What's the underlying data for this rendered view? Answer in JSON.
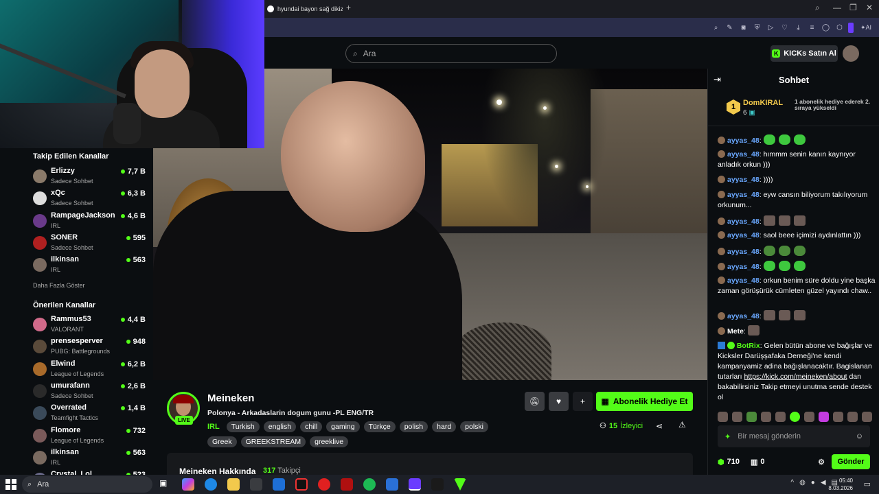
{
  "browser": {
    "tab_title": "hyundai bayon sağ dikiz a",
    "new_tab": "+",
    "controls": {
      "minimize": "—",
      "maximize": "❐",
      "close": "✕"
    },
    "ai_label": "AI"
  },
  "header": {
    "search_placeholder": "Ara",
    "buy_kicks_label": "KICKs Satın Al"
  },
  "sidebar": {
    "followed_title": "Takip Edilen Kanallar",
    "followed": [
      {
        "name": "Erlizzy",
        "category": "Sadece Sohbet",
        "viewers": "7,7 B"
      },
      {
        "name": "xQc",
        "category": "Sadece Sohbet",
        "viewers": "6,3 B"
      },
      {
        "name": "RampageJackson",
        "category": "IRL",
        "viewers": "4,6 B"
      },
      {
        "name": "SONER",
        "category": "Sadece Sohbet",
        "viewers": "595"
      },
      {
        "name": "ilkinsan",
        "category": "IRL",
        "viewers": "563"
      }
    ],
    "show_more": "Daha Fazla Göster",
    "recommended_title": "Önerilen Kanallar",
    "recommended": [
      {
        "name": "Rammus53",
        "category": "VALORANT",
        "viewers": "4,4 B"
      },
      {
        "name": "prensesperver",
        "category": "PUBG: Battlegrounds",
        "viewers": "948"
      },
      {
        "name": "Elwind",
        "category": "League of Legends",
        "viewers": "6,2 B"
      },
      {
        "name": "umurafann",
        "category": "Sadece Sohbet",
        "viewers": "2,6 B"
      },
      {
        "name": "Overrated",
        "category": "Teamfight Tactics",
        "viewers": "1,4 B"
      },
      {
        "name": "Flomore",
        "category": "League of Legends",
        "viewers": "732"
      },
      {
        "name": "ilkinsan",
        "category": "IRL",
        "viewers": "563"
      },
      {
        "name": "Crystal_Lol",
        "category": "",
        "viewers": "523"
      }
    ]
  },
  "stream": {
    "channel_name": "Meineken",
    "live_label": "LIVE",
    "title": "Polonya - Arkadaslarin dogum gunu -PL ENG/TR",
    "category": "IRL",
    "tags": [
      "Turkish",
      "english",
      "chill",
      "gaming",
      "Türkçe",
      "polish",
      "hard",
      "polski",
      "Greek",
      "GREEKSTREAM",
      "greeklive"
    ],
    "gift_sub_label": "Abonelik Hediye Et",
    "viewer_count": "15",
    "viewer_word": "İzleyici",
    "about_title": "Meineken Hakkında",
    "followers_count": "317",
    "followers_word": "Takipçi"
  },
  "chat": {
    "title": "Sohbet",
    "pinned": {
      "rank": "1",
      "name": "DomKIRAL",
      "count": "6",
      "note": "1 abonelik hediye ederek 2. sıraya yükseldi"
    },
    "messages": [
      {
        "user": "ayyas_48",
        "text": ""
      },
      {
        "user": "ayyas_48",
        "text": "hımmm senin kanın kaynıyor anladık orkun )))"
      },
      {
        "user": "ayyas_48",
        "text": "))))"
      },
      {
        "user": "ayyas_48",
        "text": "eyw cansın biliyorum takılıyorum orkunum..."
      },
      {
        "user": "ayyas_48",
        "text": ""
      },
      {
        "user": "ayyas_48",
        "text": "saol beee içimizi aydınlattın )))"
      },
      {
        "user": "ayyas_48",
        "text": ""
      },
      {
        "user": "ayyas_48",
        "text": ""
      },
      {
        "user": "ayyas_48",
        "text": "orkun benim süre doldu yine başka zaman görüşürük cümleten güzel yayındı chaw.."
      },
      {
        "user": "ayyas_48",
        "text": ""
      },
      {
        "user": "Mete",
        "text": ""
      }
    ],
    "bot": {
      "user": "BotRix",
      "text": "Gelen bütün abone ve bağışlar ve Kicksler Darüşşafaka Derneği'ne kendi kampanyamiz adina bağışlanacaktır. Bagislanan tutarları",
      "link": "https://kick.com/meineken/about",
      "text_after": "dan bakabilirsiniz Takip etmeyi unutma sende destek ol"
    },
    "input_placeholder": "Bir mesaj gönderin",
    "points": "710",
    "kicks": "0",
    "send_label": "Gönder"
  },
  "taskbar": {
    "search_placeholder": "Ara",
    "time": "05:40",
    "date": "8.03.2026"
  }
}
